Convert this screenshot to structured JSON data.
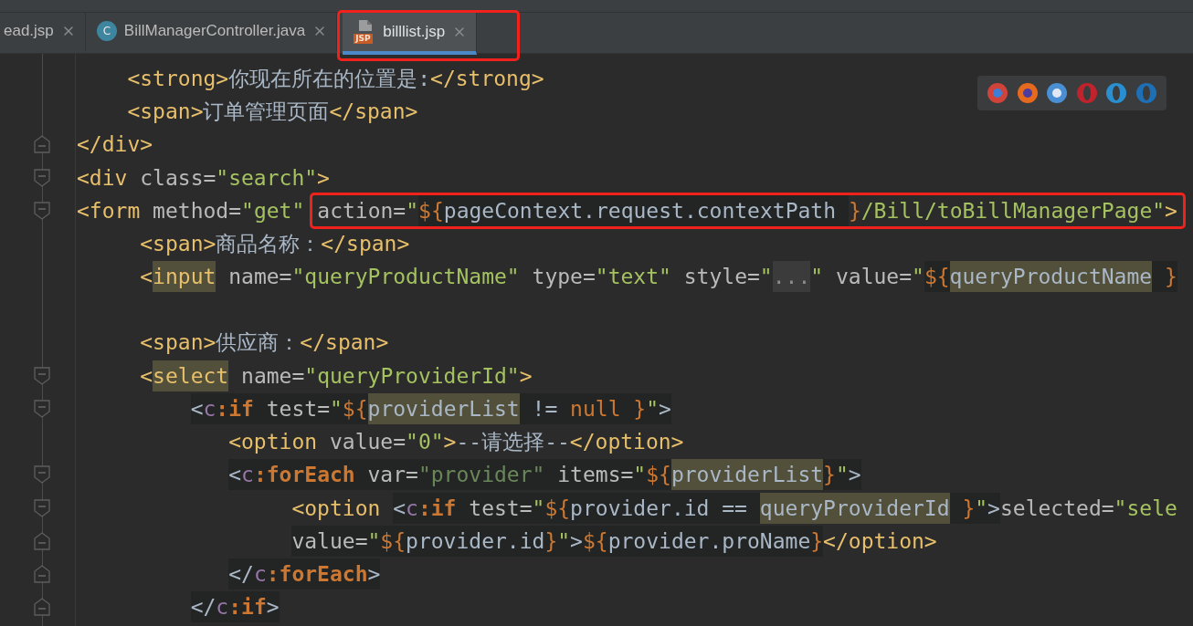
{
  "tabs": [
    {
      "label": "ead.jsp",
      "kind": "plain",
      "selected": false,
      "highlighted": false
    },
    {
      "label": "BillManagerController.java",
      "kind": "class",
      "icon_text": "C",
      "selected": false,
      "highlighted": false
    },
    {
      "label": "billlist.jsp",
      "kind": "jsp",
      "icon_text": "JSP",
      "selected": true,
      "highlighted": true
    }
  ],
  "editor": {
    "lines": [
      {
        "tokens": [
          {
            "t": "    <strong>",
            "kind": "tag"
          },
          {
            "t": "你现在所在的位置是:",
            "kind": "text"
          },
          {
            "t": "</strong>",
            "kind": "tag"
          }
        ]
      },
      {
        "tokens": [
          {
            "t": "    <span>",
            "kind": "tag"
          },
          {
            "t": "订单管理页面",
            "kind": "text"
          },
          {
            "t": "</span>",
            "kind": "tag"
          }
        ]
      },
      {
        "fold_end": true,
        "tokens": [
          {
            "t": "</div>",
            "kind": "tag"
          }
        ]
      },
      {
        "fold_start": true,
        "tokens": [
          {
            "t": "<div",
            "kind": "tag"
          },
          {
            "t": " class=",
            "kind": "attr"
          },
          {
            "t": "\"search\"",
            "kind": "str"
          },
          {
            "t": ">",
            "kind": "tag"
          }
        ]
      },
      {
        "fold_start": true,
        "tokens": [
          {
            "t": "<form",
            "kind": "tag"
          },
          {
            "t": " method=",
            "kind": "attr"
          },
          {
            "t": "\"get\"",
            "kind": "str"
          }
        ],
        "boxed_tokens": [
          {
            "t": "action=",
            "kind": "attr"
          },
          {
            "t": "\"",
            "kind": "str"
          },
          {
            "t": "${",
            "kind": "el",
            "injected": true
          },
          {
            "t": "pageContext.request.contextPath ",
            "kind": "var",
            "injected": true
          },
          {
            "t": "}",
            "kind": "el"
          },
          {
            "t": "/Bill/toBillManagerPage\"",
            "kind": "str"
          },
          {
            "t": ">",
            "kind": "tag"
          }
        ]
      },
      {
        "tokens": [
          {
            "t": "     <span>",
            "kind": "tag"
          },
          {
            "t": "商品名称：",
            "kind": "text"
          },
          {
            "t": "</span>",
            "kind": "tag"
          }
        ]
      },
      {
        "tokens": [
          {
            "t": "     <",
            "kind": "tag"
          },
          {
            "t": "input",
            "kind": "tag",
            "usage_highlight": true
          },
          {
            "t": " name=",
            "kind": "attr"
          },
          {
            "t": "\"queryProductName\"",
            "kind": "str"
          },
          {
            "t": " type=",
            "kind": "attr"
          },
          {
            "t": "\"text\"",
            "kind": "str"
          },
          {
            "t": " style=",
            "kind": "attr"
          },
          {
            "t": "\"",
            "kind": "str"
          },
          {
            "t": "...",
            "kind": "folded"
          },
          {
            "t": "\"",
            "kind": "str"
          },
          {
            "t": " value=",
            "kind": "attr"
          },
          {
            "t": "\"",
            "kind": "str"
          },
          {
            "t": "${",
            "kind": "el",
            "injected": true
          },
          {
            "t": "queryProductName",
            "kind": "var",
            "usage_highlight": true
          },
          {
            "t": " }",
            "kind": "el",
            "injected": true
          }
        ]
      },
      {
        "space_before": true,
        "tokens": [
          {
            "t": "     <span>",
            "kind": "tag"
          },
          {
            "t": "供应商：",
            "kind": "text"
          },
          {
            "t": "</span>",
            "kind": "tag"
          }
        ]
      },
      {
        "fold_start": true,
        "tokens": [
          {
            "t": "     <",
            "kind": "tag"
          },
          {
            "t": "select",
            "kind": "tag",
            "usage_highlight": true
          },
          {
            "t": " name=",
            "kind": "attr"
          },
          {
            "t": "\"queryProviderId\"",
            "kind": "str"
          },
          {
            "t": ">",
            "kind": "tag"
          }
        ]
      },
      {
        "fold_start": true,
        "tokens": [
          {
            "t": "         <",
            "kind": "punct",
            "injected": true
          },
          {
            "t": "c",
            "kind": "ns",
            "injected": true
          },
          {
            "t": ":if",
            "kind": "jstl",
            "injected": true
          },
          {
            "t": " test=",
            "kind": "attr",
            "injected": true
          },
          {
            "t": "\"",
            "kind": "str",
            "injected": true
          },
          {
            "t": "${",
            "kind": "el",
            "injected": true
          },
          {
            "t": "providerList",
            "kind": "var",
            "usage_highlight": true
          },
          {
            "t": " != ",
            "kind": "var",
            "injected": true
          },
          {
            "t": "null }",
            "kind": "el",
            "injected": true
          },
          {
            "t": "\"",
            "kind": "str",
            "injected": true
          },
          {
            "t": ">",
            "kind": "punct",
            "injected": true
          }
        ]
      },
      {
        "tokens": [
          {
            "t": "            <option",
            "kind": "tag"
          },
          {
            "t": " value=",
            "kind": "attr"
          },
          {
            "t": "\"0\"",
            "kind": "str"
          },
          {
            "t": ">",
            "kind": "tag"
          },
          {
            "t": "--请选择--",
            "kind": "text"
          },
          {
            "t": "</option>",
            "kind": "tag"
          }
        ]
      },
      {
        "fold_start": true,
        "tokens": [
          {
            "t": "            <",
            "kind": "punct",
            "injected": true
          },
          {
            "t": "c",
            "kind": "ns",
            "injected": true
          },
          {
            "t": ":forEach",
            "kind": "jstl",
            "injected": true
          },
          {
            "t": " var=",
            "kind": "attr",
            "injected": true
          },
          {
            "t": "\"provider\"",
            "kind": "str2",
            "injected": true
          },
          {
            "t": " items=",
            "kind": "attr",
            "injected": true
          },
          {
            "t": "\"",
            "kind": "str",
            "injected": true
          },
          {
            "t": "${",
            "kind": "el",
            "injected": true
          },
          {
            "t": "providerList",
            "kind": "var",
            "usage_highlight": true
          },
          {
            "t": "}",
            "kind": "el",
            "injected": true
          },
          {
            "t": "\"",
            "kind": "str",
            "injected": true
          },
          {
            "t": ">",
            "kind": "punct",
            "injected": true
          }
        ]
      },
      {
        "fold_start": true,
        "tokens": [
          {
            "t": "                 <option ",
            "kind": "tag"
          },
          {
            "t": "<",
            "kind": "punct",
            "injected": true
          },
          {
            "t": "c",
            "kind": "ns",
            "injected": true
          },
          {
            "t": ":if",
            "kind": "jstl",
            "injected": true
          },
          {
            "t": " test=",
            "kind": "attr",
            "injected": true
          },
          {
            "t": "\"",
            "kind": "str",
            "injected": true
          },
          {
            "t": "${",
            "kind": "el",
            "injected": true
          },
          {
            "t": "provider.id == ",
            "kind": "var",
            "injected": true
          },
          {
            "t": "queryProviderId",
            "kind": "var",
            "usage_highlight": true
          },
          {
            "t": " }",
            "kind": "el",
            "injected": true
          },
          {
            "t": "\"",
            "kind": "str",
            "injected": true
          },
          {
            "t": ">",
            "kind": "punct",
            "injected": true
          },
          {
            "t": "selected=",
            "kind": "attr"
          },
          {
            "t": "\"sele",
            "kind": "str"
          }
        ]
      },
      {
        "fold_end": true,
        "tokens": [
          {
            "t": "                 value=",
            "kind": "attr",
            "injected": true
          },
          {
            "t": "\"",
            "kind": "str",
            "injected": true
          },
          {
            "t": "${",
            "kind": "el",
            "injected": true
          },
          {
            "t": "provider.id",
            "kind": "var",
            "injected": true
          },
          {
            "t": "}",
            "kind": "el",
            "injected": true
          },
          {
            "t": "\"",
            "kind": "str",
            "injected": true
          },
          {
            "t": ">",
            "kind": "punct",
            "injected": true
          },
          {
            "t": "${",
            "kind": "el",
            "injected": true
          },
          {
            "t": "provider.proName",
            "kind": "var",
            "injected": true
          },
          {
            "t": "}",
            "kind": "el",
            "injected": true
          },
          {
            "t": "</option>",
            "kind": "tag"
          }
        ]
      },
      {
        "fold_end": true,
        "tokens": [
          {
            "t": "            </",
            "kind": "punct",
            "injected": true
          },
          {
            "t": "c",
            "kind": "ns",
            "injected": true
          },
          {
            "t": ":forEach",
            "kind": "jstl",
            "injected": true
          },
          {
            "t": ">",
            "kind": "punct",
            "injected": true
          }
        ]
      },
      {
        "fold_end": true,
        "tokens": [
          {
            "t": "         </",
            "kind": "punct",
            "injected": true
          },
          {
            "t": "c",
            "kind": "ns",
            "injected": true
          },
          {
            "t": ":if",
            "kind": "jstl",
            "injected": true
          },
          {
            "t": ">",
            "kind": "punct",
            "injected": true
          }
        ]
      }
    ]
  }
}
